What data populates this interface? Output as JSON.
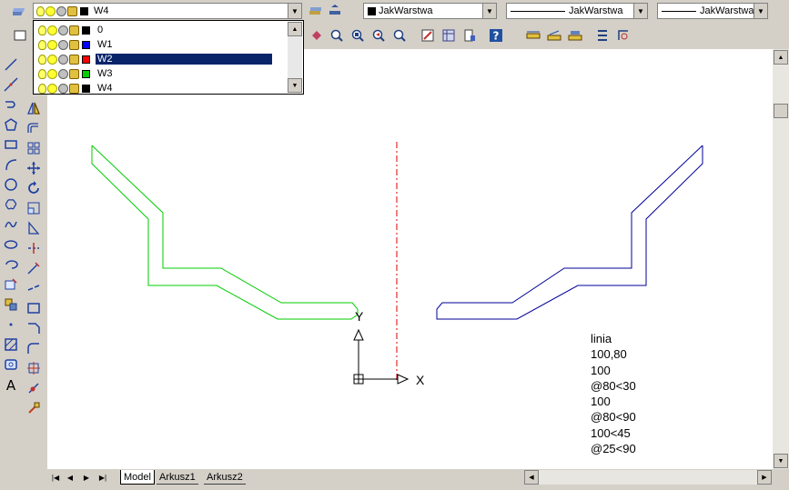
{
  "toolbar": {
    "layer_combo_value": "W4",
    "color_combo_value": "JakWarstwa",
    "linetype_combo_value": "JakWarstwa",
    "lineweight_combo_value": "JakWarstwa"
  },
  "layer_dropdown": {
    "items": [
      {
        "name": "0",
        "color": "#000000"
      },
      {
        "name": "W1",
        "color": "#0000ff"
      },
      {
        "name": "W2",
        "color": "#ff0000"
      },
      {
        "name": "W3",
        "color": "#00cc00"
      },
      {
        "name": "W4",
        "color": "#000000"
      }
    ],
    "selected_index": 2
  },
  "canvas": {
    "axis_x_label": "X",
    "axis_y_label": "Y",
    "command_lines": [
      "linia",
      "100,80",
      "100",
      "@80<30",
      "100",
      "@80<90",
      "100<45",
      "@25<90"
    ]
  },
  "tabs": {
    "model": "Model",
    "sheet1": "Arkusz1",
    "sheet2": "Arkusz2"
  }
}
